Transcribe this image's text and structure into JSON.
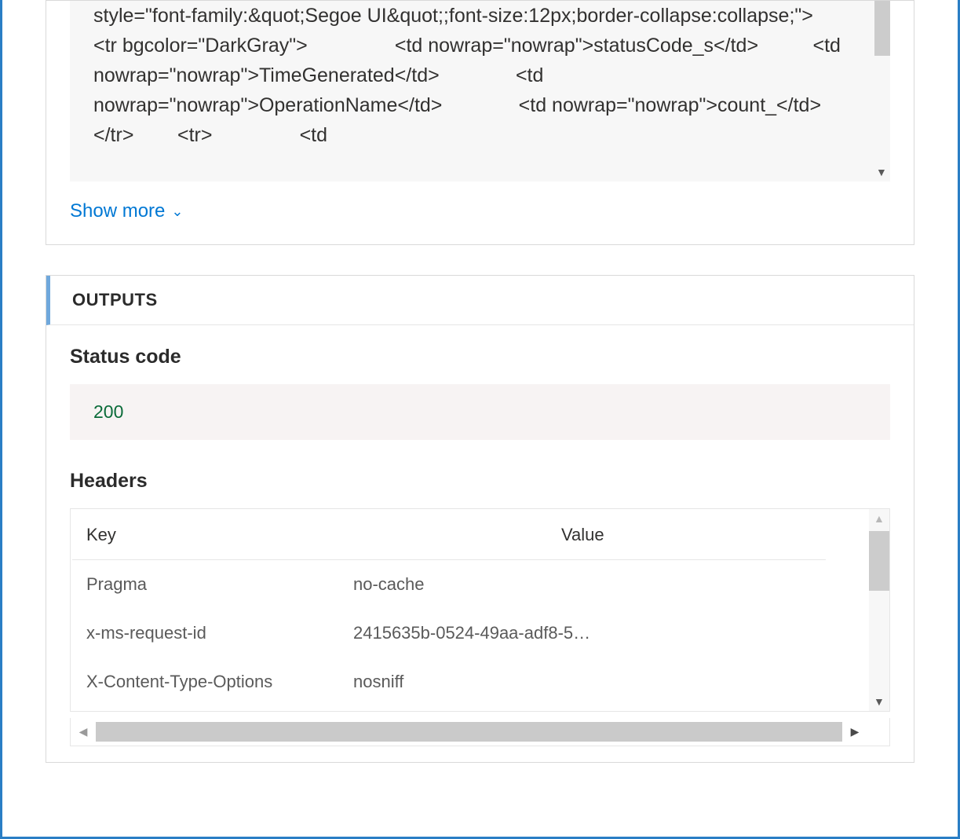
{
  "inputs": {
    "code_text": "style=\"font-family:&quot;Segoe UI&quot;;font-size:12px;border-collapse:collapse;\">        <tr bgcolor=\"DarkGray\">                <td nowrap=\"nowrap\">statusCode_s</td>          <td nowrap=\"nowrap\">TimeGenerated</td>              <td nowrap=\"nowrap\">OperationName</td>              <td nowrap=\"nowrap\">count_</td>    </tr>        <tr>                <td",
    "show_more_label": "Show more"
  },
  "outputs": {
    "header": "OUTPUTS",
    "status_label": "Status code",
    "status_value": "200",
    "headers_label": "Headers",
    "headers_table": {
      "key_header": "Key",
      "value_header": "Value",
      "rows": [
        {
          "key": "Pragma",
          "value": "no-cache"
        },
        {
          "key": "x-ms-request-id",
          "value": "2415635b-0524-49aa-adf8-54..."
        },
        {
          "key": "X-Content-Type-Options",
          "value": "nosniff"
        }
      ]
    }
  }
}
